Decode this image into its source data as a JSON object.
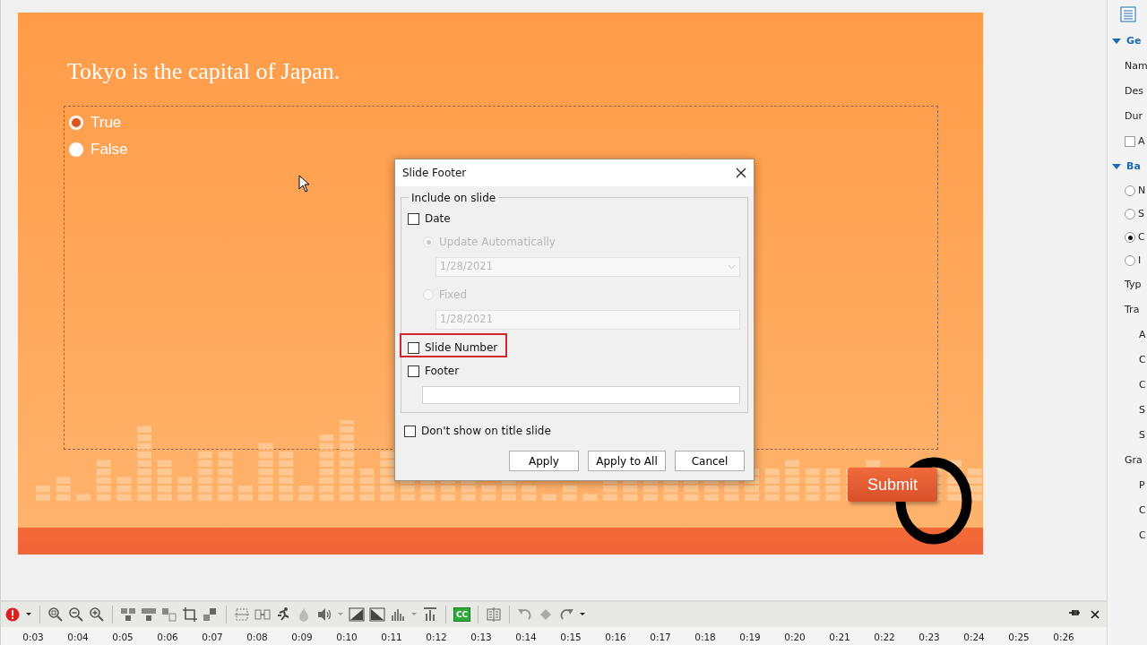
{
  "slide": {
    "question": "Tokyo is the capital of Japan.",
    "answers": [
      {
        "label": "True",
        "selected": true
      },
      {
        "label": "False",
        "selected": false
      }
    ],
    "submit": "Submit"
  },
  "dialog": {
    "title": "Slide Footer",
    "group_label": "Include on slide",
    "date": {
      "label": "Date",
      "checked": false
    },
    "date_modes": [
      {
        "label": "Update Automatically",
        "selected": true,
        "disabled": true,
        "field": {
          "value": "1/28/2021",
          "kind": "dropdown"
        }
      },
      {
        "label": "Fixed",
        "selected": false,
        "disabled": true,
        "field": {
          "value": "1/28/2021",
          "kind": "text"
        }
      }
    ],
    "slide_number": {
      "label": "Slide Number",
      "checked": false,
      "highlighted": true
    },
    "footer": {
      "label": "Footer",
      "checked": false
    },
    "dont_show": {
      "label": "Don't show on title slide",
      "checked": false
    },
    "buttons": [
      "Apply",
      "Apply to All",
      "Cancel"
    ]
  },
  "toolbar": {
    "cc_label": "CC"
  },
  "timeline": {
    "ticks": [
      "0:03",
      "0:04",
      "0:05",
      "0:06",
      "0:07",
      "0:08",
      "0:09",
      "0:10",
      "0:11",
      "0:12",
      "0:13",
      "0:14",
      "0:15",
      "0:16",
      "0:17",
      "0:18",
      "0:19",
      "0:20",
      "0:21",
      "0:22",
      "0:23",
      "0:24",
      "0:25",
      "0:26"
    ]
  },
  "properties_panel": {
    "items": [
      {
        "kind": "heading",
        "label": "Ge",
        "expanded": true
      },
      {
        "kind": "label",
        "label": "Nam"
      },
      {
        "kind": "label",
        "label": "Des"
      },
      {
        "kind": "label",
        "label": "Dur"
      },
      {
        "kind": "checkbox",
        "label": "A",
        "checked": false
      },
      {
        "kind": "heading",
        "label": "Ba",
        "expanded": true
      },
      {
        "kind": "radio",
        "label": "N",
        "selected": false
      },
      {
        "kind": "radio",
        "label": "S",
        "selected": false
      },
      {
        "kind": "radio",
        "label": "C",
        "selected": true
      },
      {
        "kind": "radio",
        "label": "I",
        "selected": false
      },
      {
        "kind": "label",
        "label": "Typ"
      },
      {
        "kind": "label",
        "label": "Tra"
      },
      {
        "kind": "sublabel",
        "label": "A"
      },
      {
        "kind": "sublabel",
        "label": "C"
      },
      {
        "kind": "sublabel",
        "label": "C"
      },
      {
        "kind": "sublabel",
        "label": "S"
      },
      {
        "kind": "sublabel",
        "label": "S"
      },
      {
        "kind": "label",
        "label": "Gra"
      },
      {
        "kind": "sublabel",
        "label": "P"
      },
      {
        "kind": "sublabel",
        "label": "C"
      },
      {
        "kind": "sublabel",
        "label": "C"
      }
    ]
  }
}
